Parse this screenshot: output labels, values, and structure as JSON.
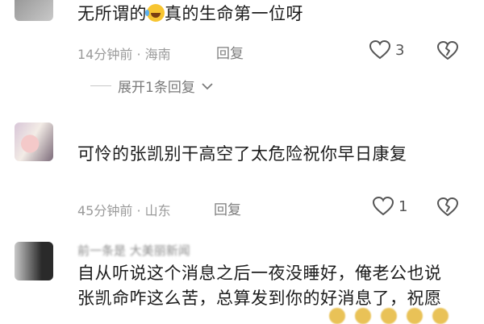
{
  "comments": [
    {
      "text_before": "无所谓的",
      "text_after": "真的生命第一位呀",
      "emoji": "laughing-tears-icon",
      "time": "14分钟前",
      "location": "海南",
      "reply_label": "回复",
      "likes": "3",
      "expand_label": "展开1条回复"
    },
    {
      "text": "可怜的张凯别干高空了太危险祝你早日康复",
      "time": "45分钟前",
      "location": "山东",
      "reply_label": "回复",
      "likes": "1"
    },
    {
      "quoted": "前一条是 大美丽新闻",
      "text": "自从听说这个消息之后一夜没睡好，俺老公也说张凯命咋这么苦，总算发到你的好消息了，祝愿"
    }
  ],
  "separator": "·",
  "colors": {
    "text": "#1c1c1c",
    "meta": "#9a9a9a",
    "icon": "#555555"
  }
}
